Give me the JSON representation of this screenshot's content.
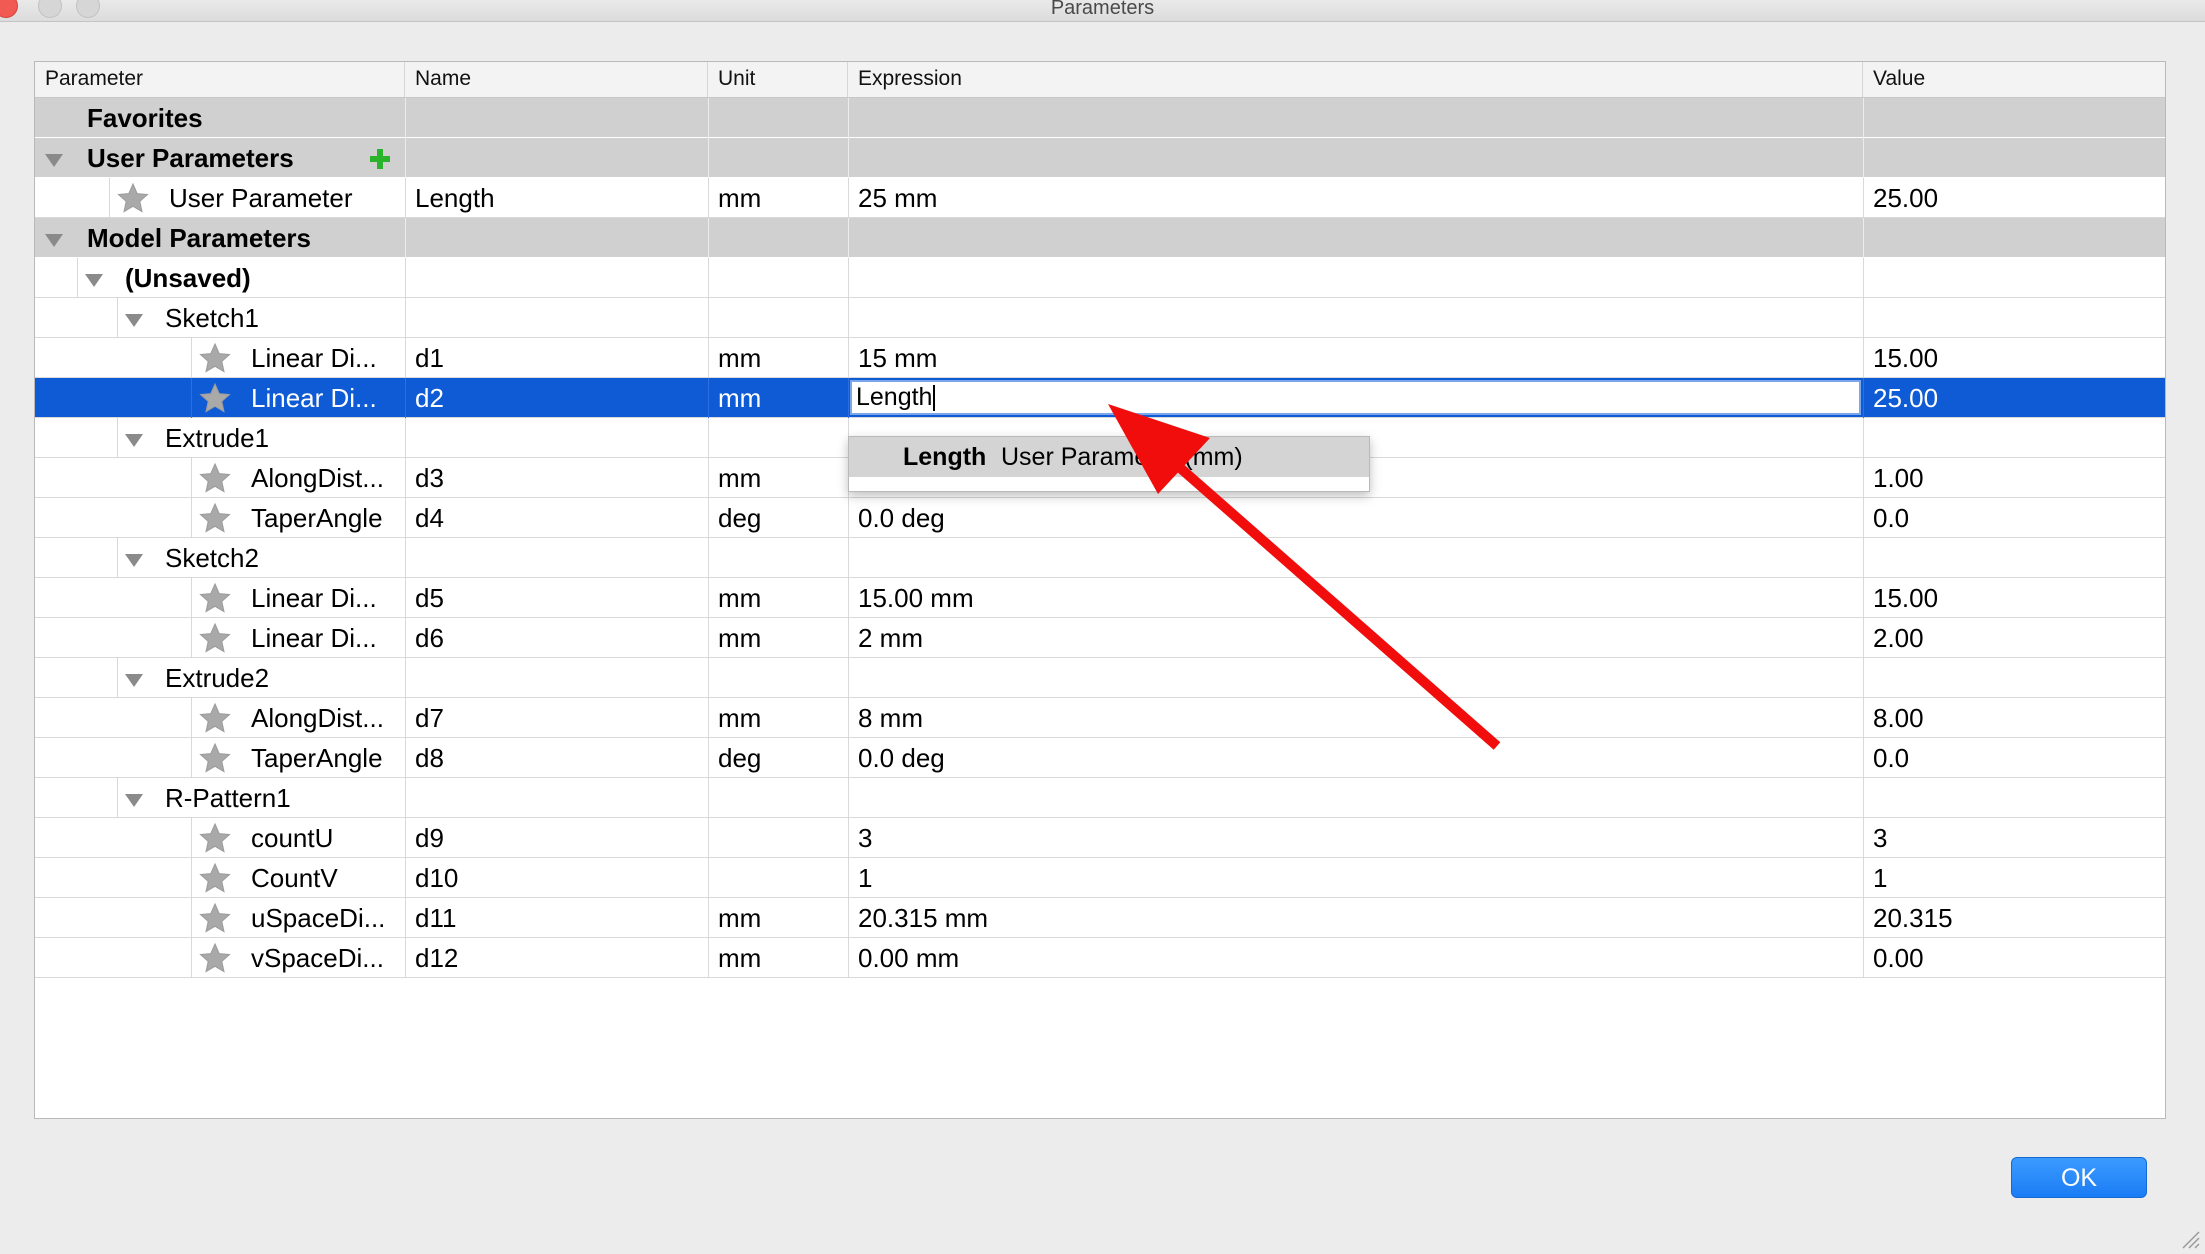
{
  "window": {
    "title": "Parameters"
  },
  "columns": [
    "Parameter",
    "Name",
    "Unit",
    "Expression",
    "Value"
  ],
  "rows": [
    {
      "kind": "group",
      "level": 0,
      "expand": false,
      "label": "Favorites"
    },
    {
      "kind": "group",
      "level": 0,
      "expand": true,
      "label": "User Parameters",
      "add": true
    },
    {
      "kind": "param",
      "level": 1,
      "star": true,
      "label": "User Parameter",
      "name": "Length",
      "unit": "mm",
      "expr": "25 mm",
      "value": "25.00"
    },
    {
      "kind": "group",
      "level": 0,
      "expand": true,
      "label": "Model Parameters"
    },
    {
      "kind": "node",
      "level": 1,
      "expand": true,
      "label": "(Unsaved)",
      "bold": true
    },
    {
      "kind": "node",
      "level": 2,
      "expand": true,
      "label": "Sketch1"
    },
    {
      "kind": "param",
      "level": 3,
      "star": true,
      "label": "Linear Di...",
      "name": "d1",
      "unit": "mm",
      "expr": "15 mm",
      "value": "15.00"
    },
    {
      "kind": "param",
      "level": 3,
      "star": true,
      "label": "Linear Di...",
      "name": "d2",
      "unit": "mm",
      "expr": "Length",
      "value": "25.00",
      "selected": true,
      "editing": true
    },
    {
      "kind": "node",
      "level": 2,
      "expand": true,
      "label": "Extrude1"
    },
    {
      "kind": "param",
      "level": 3,
      "star": true,
      "label": "AlongDist...",
      "name": "d3",
      "unit": "mm",
      "expr": "",
      "value": "1.00"
    },
    {
      "kind": "param",
      "level": 3,
      "star": true,
      "label": "TaperAngle",
      "name": "d4",
      "unit": "deg",
      "expr": "0.0 deg",
      "value": "0.0"
    },
    {
      "kind": "node",
      "level": 2,
      "expand": true,
      "label": "Sketch2"
    },
    {
      "kind": "param",
      "level": 3,
      "star": true,
      "label": "Linear Di...",
      "name": "d5",
      "unit": "mm",
      "expr": "15.00 mm",
      "value": "15.00"
    },
    {
      "kind": "param",
      "level": 3,
      "star": true,
      "label": "Linear Di...",
      "name": "d6",
      "unit": "mm",
      "expr": "2 mm",
      "value": "2.00"
    },
    {
      "kind": "node",
      "level": 2,
      "expand": true,
      "label": "Extrude2"
    },
    {
      "kind": "param",
      "level": 3,
      "star": true,
      "label": "AlongDist...",
      "name": "d7",
      "unit": "mm",
      "expr": "8 mm",
      "value": "8.00"
    },
    {
      "kind": "param",
      "level": 3,
      "star": true,
      "label": "TaperAngle",
      "name": "d8",
      "unit": "deg",
      "expr": "0.0 deg",
      "value": "0.0"
    },
    {
      "kind": "node",
      "level": 2,
      "expand": true,
      "label": "R-Pattern1"
    },
    {
      "kind": "param",
      "level": 3,
      "star": true,
      "label": "countU",
      "name": "d9",
      "unit": "",
      "expr": "3",
      "value": "3"
    },
    {
      "kind": "param",
      "level": 3,
      "star": true,
      "label": "CountV",
      "name": "d10",
      "unit": "",
      "expr": "1",
      "value": "1"
    },
    {
      "kind": "param",
      "level": 3,
      "star": true,
      "label": "uSpaceDi...",
      "name": "d11",
      "unit": "mm",
      "expr": "20.315 mm",
      "value": "20.315"
    },
    {
      "kind": "param",
      "level": 3,
      "star": true,
      "label": "vSpaceDi...",
      "name": "d12",
      "unit": "mm",
      "expr": "0.00 mm",
      "value": "0.00"
    }
  ],
  "autocomplete": {
    "name": "Length",
    "description": "User Parameter (mm)"
  },
  "buttons": {
    "ok": "OK"
  },
  "colors": {
    "selection": "#0f5bd6",
    "annotation_arrow": "#f20d0d",
    "add_icon": "#2bb32b"
  }
}
